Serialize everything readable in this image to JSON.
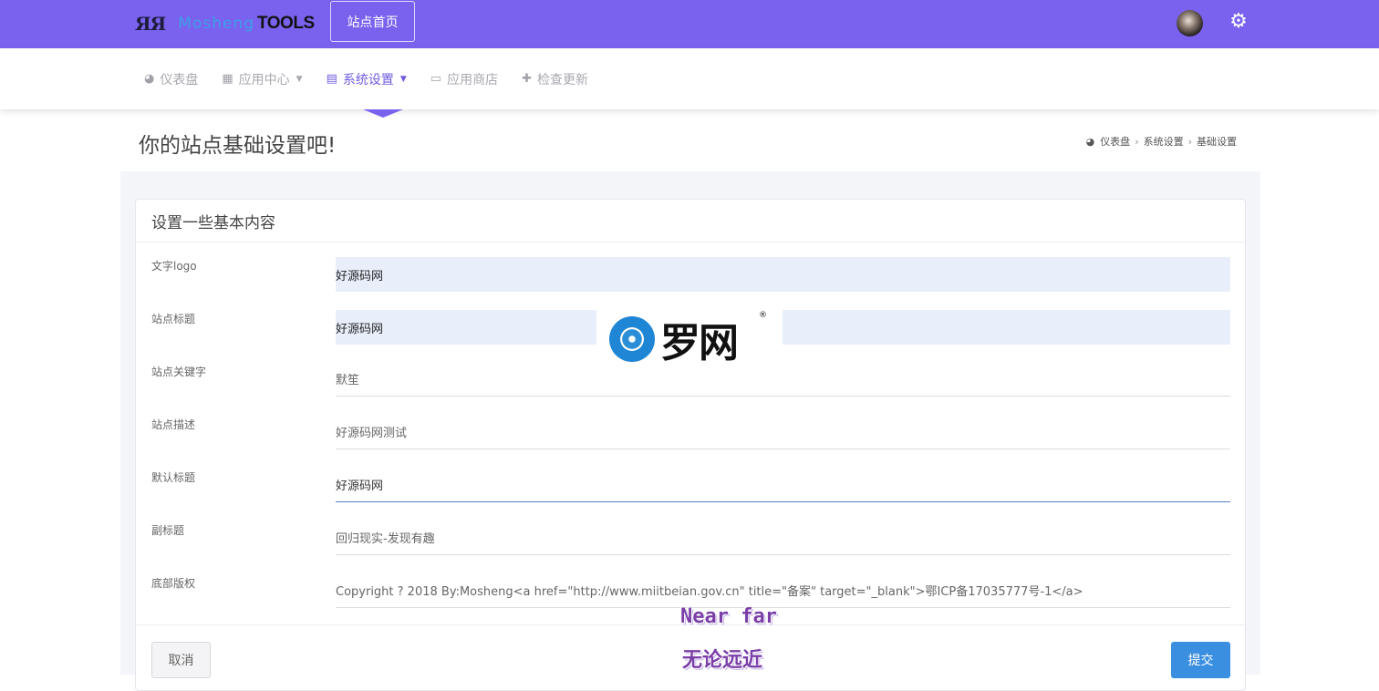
{
  "topbar": {
    "brand_mark": "ЯЯ",
    "brand_script": "Mosheng",
    "brand_tools": "TOOLS",
    "home_button": "站点首页",
    "accent_color": "#7a62ef"
  },
  "nav": {
    "items": [
      {
        "label": "仪表盘",
        "icon": "dashboard-icon",
        "dropdown": false,
        "active": false
      },
      {
        "label": "应用中心",
        "icon": "grid-icon",
        "dropdown": true,
        "active": false
      },
      {
        "label": "系统设置",
        "icon": "table-icon",
        "dropdown": true,
        "active": true
      },
      {
        "label": "应用商店",
        "icon": "laptop-icon",
        "dropdown": false,
        "active": false
      },
      {
        "label": "检查更新",
        "icon": "puzzle-icon",
        "dropdown": false,
        "active": false
      }
    ]
  },
  "page": {
    "title": "你的站点基础设置吧!",
    "breadcrumb": [
      "仪表盘",
      "系统设置",
      "基础设置"
    ]
  },
  "card": {
    "title": "设置一些基本内容",
    "fields": [
      {
        "label": "文字logo",
        "value": "好源码网"
      },
      {
        "label": "站点标题",
        "value": "好源码网"
      },
      {
        "label": "站点关键字",
        "value": "默笙"
      },
      {
        "label": "站点描述",
        "value": "好源码网测试"
      },
      {
        "label": "默认标题",
        "value": "好源码网"
      },
      {
        "label": "副标题",
        "value": "回归现实-发现有趣"
      },
      {
        "label": "底部版权",
        "value": "Copyright ? 2018 By:Mosheng<a href=\"http://www.miitbeian.gov.cn\" title=\"备案\" target=\"_blank\">鄂ICP备17035777号-1</a>"
      }
    ],
    "cancel_label": "取消",
    "submit_label": "提交"
  },
  "watermark": {
    "logo_text": "罗网",
    "reg": "®",
    "line1": "Near far",
    "line2": "无论远近"
  }
}
